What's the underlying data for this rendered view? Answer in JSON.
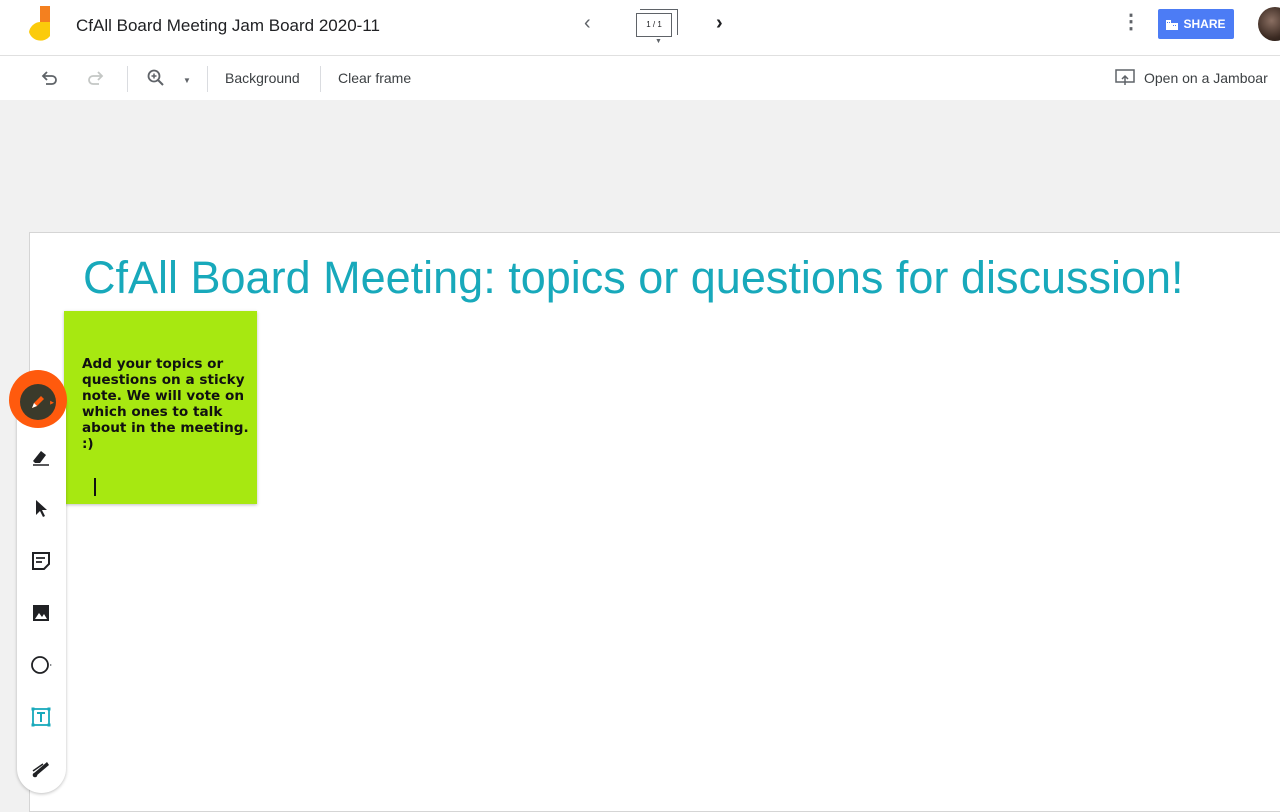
{
  "header": {
    "doc_title": "CfAll Board Meeting Jam Board 2020-11",
    "frame_counter": "1 / 1",
    "prev_icon": "chevron-left-icon",
    "next_icon": "chevron-right-icon",
    "more_icon": "more-vert-icon",
    "share_label": "SHARE"
  },
  "toolbar": {
    "undo_icon": "undo-icon",
    "redo_icon": "redo-icon",
    "zoom_icon": "zoom-in-icon",
    "background_label": "Background",
    "clear_frame_label": "Clear frame",
    "open_on_jamboard_label": "Open on a Jamboar"
  },
  "board": {
    "title": "CfAll Board Meeting: topics or questions for discussion!",
    "title_color": "#18a9bb",
    "sticky_note_text": "Add your topics or questions on a sticky note. We will vote on which ones to talk about in the meeting. :)",
    "sticky_note_color": "#a7e811"
  },
  "tools": [
    "pen",
    "eraser",
    "select",
    "sticky-note",
    "image",
    "circle",
    "text-box",
    "laser"
  ],
  "colors": {
    "share_button": "#4c7cf5",
    "pen_highlight": "#ff5a0d",
    "logo_orange": "#f4801f",
    "logo_yellow": "#fbcb0b"
  }
}
